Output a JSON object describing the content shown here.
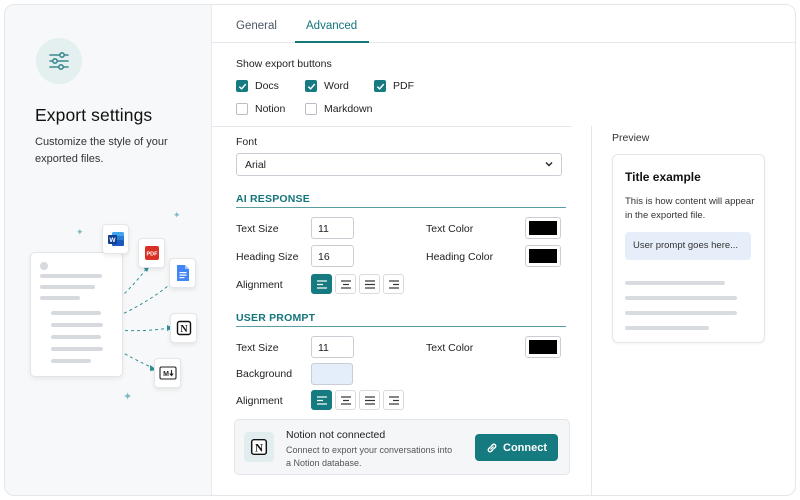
{
  "left_panel": {
    "title": "Export settings",
    "description": "Customize the style of your exported files.",
    "icon": "sliders-icon",
    "illustration_apps": [
      "word-icon",
      "pdf-icon",
      "google-docs-icon",
      "notion-icon",
      "markdown-icon"
    ]
  },
  "tabs": [
    {
      "label": "General",
      "active": false
    },
    {
      "label": "Advanced",
      "active": true
    }
  ],
  "export_buttons": {
    "label": "Show export buttons",
    "options": [
      {
        "label": "Docs",
        "checked": true
      },
      {
        "label": "Word",
        "checked": true
      },
      {
        "label": "PDF",
        "checked": true
      },
      {
        "label": "Notion",
        "checked": false
      },
      {
        "label": "Markdown",
        "checked": false
      }
    ]
  },
  "font": {
    "label": "Font",
    "value": "Arial"
  },
  "ai_response": {
    "heading": "AI RESPONSE",
    "text_size_label": "Text Size",
    "text_size": "11",
    "heading_size_label": "Heading Size",
    "heading_size": "16",
    "text_color_label": "Text Color",
    "text_color": "#000000",
    "heading_color_label": "Heading Color",
    "heading_color": "#000000",
    "alignment_label": "Alignment",
    "alignment_selected": "left"
  },
  "user_prompt": {
    "heading": "USER PROMPT",
    "text_size_label": "Text Size",
    "text_size": "11",
    "text_color_label": "Text Color",
    "text_color": "#000000",
    "background_label": "Background",
    "background_color": "#e4eefb",
    "alignment_label": "Alignment",
    "alignment_selected": "left"
  },
  "notion": {
    "title": "Notion not connected",
    "description": "Connect to export your conversations into a Notion database.",
    "button_label": "Connect"
  },
  "preview": {
    "label": "Preview",
    "title": "Title example",
    "body": "This is how content will appear in the exported file.",
    "prompt": "User prompt goes here..."
  },
  "colors": {
    "accent": "#157b80",
    "accent_text": "#14757b"
  }
}
